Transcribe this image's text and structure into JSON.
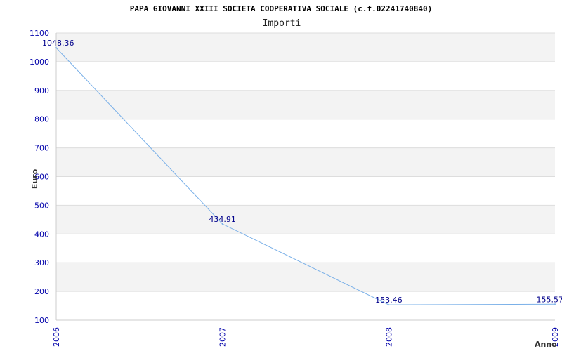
{
  "chart_data": {
    "type": "line",
    "title": "PAPA GIOVANNI XXIII SOCIETA COOPERATIVA SOCIALE (c.f.02241740840)",
    "subtitle": "Importi",
    "xlabel": "Anno",
    "ylabel": "Euro",
    "categories": [
      "2006",
      "2007",
      "2008",
      "2009"
    ],
    "series": [
      {
        "values": [
          1048.36,
          434.91,
          153.46,
          155.57
        ]
      }
    ],
    "data_labels": [
      "1048.36",
      "434.91",
      "153.46",
      "155.57"
    ],
    "y_ticks": [
      "100",
      "200",
      "300",
      "400",
      "500",
      "600",
      "700",
      "800",
      "900",
      "1000",
      "1100"
    ],
    "ylim": [
      100,
      1100
    ],
    "grid": true,
    "line_color": "#7ab0e8",
    "band_color": "#f3f3f3",
    "tick_color": "#0000aa",
    "label_color": "#00008b"
  }
}
